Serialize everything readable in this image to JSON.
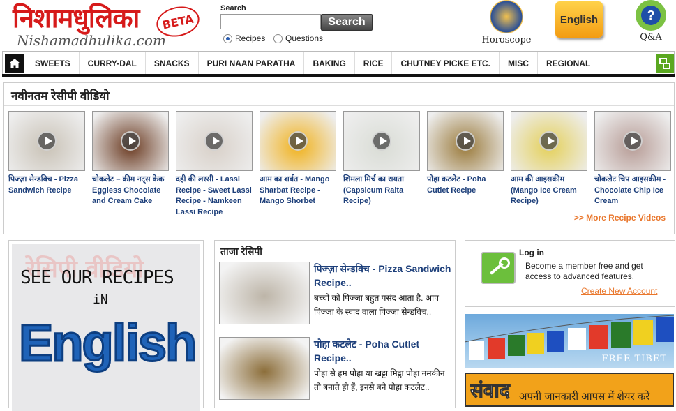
{
  "header": {
    "logo_hindi": "निशामधुलिका",
    "logo_english": "Nishamadhulika.com",
    "beta_badge": "BETA",
    "search_label": "Search",
    "search_value": "",
    "search_button": "Search",
    "radio_recipes": "Recipes",
    "radio_questions": "Questions",
    "horoscope_label": "Horoscope",
    "english_label": "English",
    "qa_label": "Q&A"
  },
  "nav": {
    "items": [
      "SWEETS",
      "CURRY-DAL",
      "SNACKS",
      "PURI NAAN PARATHA",
      "BAKING",
      "RICE",
      "CHUTNEY PICKE ETC.",
      "MISC",
      "REGIONAL"
    ]
  },
  "videos": {
    "title": "नवीनतम रेसीपी वीडियो",
    "items": [
      {
        "caption": "पिज्ज़ा सेन्डविच - Pizza Sandwich Recipe",
        "color": "#c9c2b6"
      },
      {
        "caption": "चोकलेट – क्रीम नट्स केक Eggless Chocolate and Cream Cake",
        "color": "#6b3b22"
      },
      {
        "caption": "दही की लस्सी - Lassi Recipe - Sweet Lassi Recipe - Namkeen Lassi Recipe",
        "color": "#d8d0c8"
      },
      {
        "caption": "आम का शर्बत - Mango Sharbat Recipe - Mango Shorbet",
        "color": "#f1b21d"
      },
      {
        "caption": "शिमला मिर्च का रायता (Capsicum Raita Recipe)",
        "color": "#d9dcd5"
      },
      {
        "caption": "पोहा कटलेट - Poha Cutlet Recipe",
        "color": "#9a7a3b"
      },
      {
        "caption": "आम की आइसक्रीम (Mango Ice Cream Recipe)",
        "color": "#e4d05a"
      },
      {
        "caption": "चोकलेट चिप आइसक्रीम - Chocolate Chip Ice Cream",
        "color": "#b79c96"
      }
    ],
    "more_link": ">> More Recipe Videos"
  },
  "promo": {
    "faint_text": "रेसिपी वीडियो",
    "line1": "SEE OUR RECIPES",
    "line2": "iN",
    "big": "English"
  },
  "fresh": {
    "title": "ताजा रेसिपी",
    "items": [
      {
        "title": "पिज्ज़ा सेन्डविच - Pizza Sandwich Recipe..",
        "desc": "बच्चों को पिज्जा बहुत पसंद आता है. आप पिज्जा के स्वाद वाला पिज्जा सेन्डविच..",
        "color": "#bdb5a8"
      },
      {
        "title": "पोहा कटलेट - Poha Cutlet Recipe..",
        "desc": "पोहा से हम पोहा या खट्टा मिट्ठा पोहा नमकीन तो बनाते ही हैं, इनसे बने पोहा कटलेट..",
        "color": "#8c6e3a"
      }
    ]
  },
  "login": {
    "title": "Log in",
    "text": "Become a member free and get access to advanced features.",
    "link": "Create New Account"
  },
  "tibet": {
    "caption": "FREE TIBET"
  },
  "samvad": {
    "big": "संवाद",
    "small": "अपनी जानकारी आपस में शेयर करें"
  }
}
